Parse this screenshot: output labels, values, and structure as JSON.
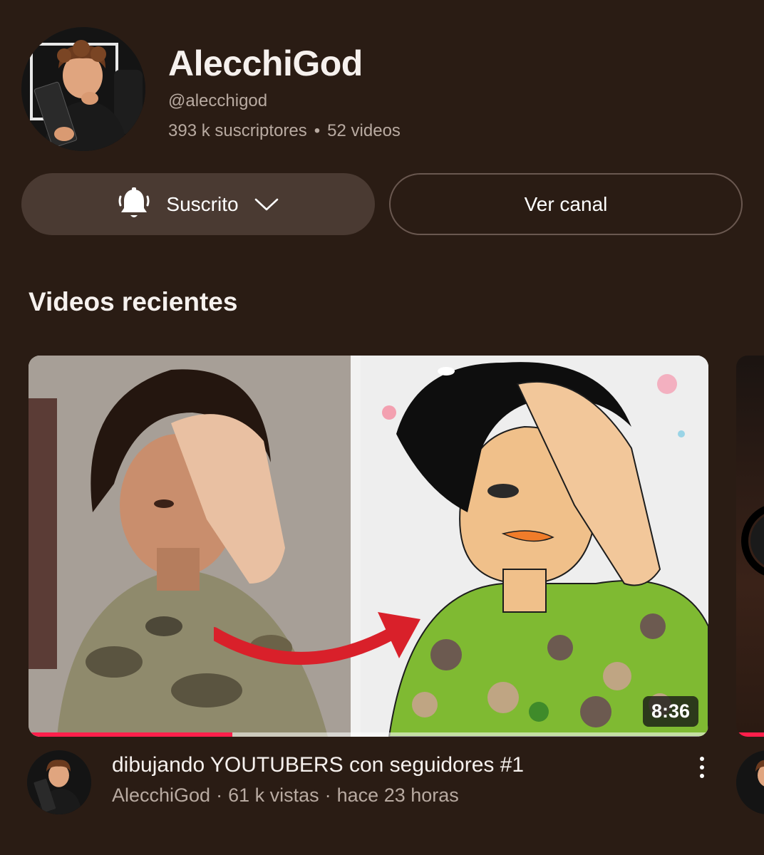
{
  "channel": {
    "name": "AlecchiGod",
    "handle": "@alecchigod",
    "subscribers": "393 k suscriptores",
    "separator": "•",
    "video_count": "52 videos"
  },
  "buttons": {
    "subscribed_label": "Suscrito",
    "view_channel_label": "Ver canal"
  },
  "section": {
    "title": "Videos recientes"
  },
  "video": {
    "title": "dibujando YOUTUBERS con seguidores #1",
    "channel": "AlecchiGod",
    "dot": "·",
    "views": "61 k vistas",
    "age": "hace 23 horas",
    "duration": "8:36",
    "watch_progress_percent": 30
  },
  "colors": {
    "background": "#2a1c14",
    "progress": "#ff1f4b",
    "secondary_text": "#b8aaa1"
  },
  "icons": {
    "bell": "bell-icon",
    "chevron": "chevron-down-icon",
    "more": "more-vert-icon"
  }
}
